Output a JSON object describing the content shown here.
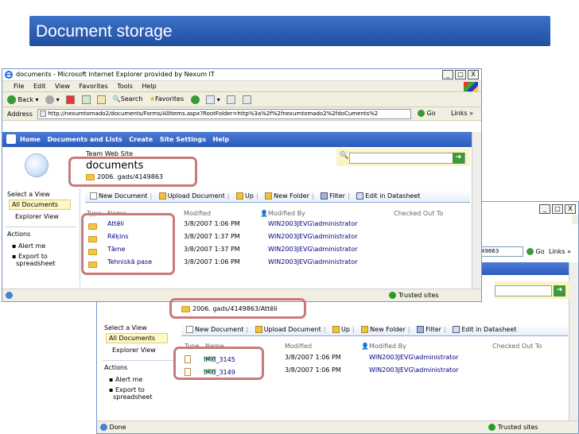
{
  "slide": {
    "title": "Document storage"
  },
  "browser": {
    "window_title": "documents - Microsoft Internet Explorer provided by Nexum IT",
    "window_buttons": [
      "_",
      "□",
      "X"
    ],
    "menu": [
      "File",
      "Edit",
      "View",
      "Favorites",
      "Tools",
      "Help"
    ],
    "toolbar": {
      "back": "Back",
      "search": "Search",
      "favorites": "Favorites"
    },
    "address_label": "Address",
    "address_value": "http://nexumtomado2/documents/Forms/AllItems.aspx?RootFolder=http%3a%2f%2fnexumtomado2%2fdoCuments%2",
    "address_value_short": "49863",
    "go": "Go",
    "links": "Links",
    "more": "»"
  },
  "sharepoint": {
    "topnav": [
      "Home",
      "Documents and Lists",
      "Create",
      "Site Settings",
      "Help"
    ],
    "site_name": "Team Web Site",
    "library_title": "documents",
    "breadcrumb_1": "2006. gads/4149863",
    "breadcrumb_2": "2006. gads/4149863/Attēli",
    "left_nav": {
      "select_view": "Select a View",
      "all_documents": "All Documents",
      "explorer_view": "Explorer View",
      "actions": "Actions",
      "alert_me": "Alert me",
      "export_1": "Export to",
      "export_2": "spreadsheet"
    },
    "doc_toolbar": [
      "New Document",
      "Upload Document",
      "Up",
      "New Folder",
      "Filter",
      "Edit in Datasheet"
    ],
    "columns": {
      "type": "Type",
      "name": "Name",
      "modified": "Modified",
      "modified_by": "Modified By",
      "checked_out_to": "Checked Out To"
    },
    "folders": [
      {
        "name": "Attēli",
        "modified": "3/8/2007 1:06 PM",
        "by": "WIN2003JEVG\\administrator"
      },
      {
        "name": "Rēķins",
        "modified": "3/8/2007 1:37 PM",
        "by": "WIN2003JEVG\\administrator"
      },
      {
        "name": "Tāme",
        "modified": "3/8/2007 1:37 PM",
        "by": "WIN2003JEVG\\administrator"
      },
      {
        "name": "Tehniskā pase",
        "modified": "3/8/2007 1:06 PM",
        "by": "WIN2003JEVG\\administrator"
      }
    ],
    "images": [
      {
        "name": "IMG_3145",
        "badge": "NEW",
        "modified": "3/8/2007 1:06 PM",
        "by": "WIN2003JEVG\\administrator"
      },
      {
        "name": "IMG_3149",
        "badge": "NEW",
        "modified": "3/8/2007 1:06 PM",
        "by": "WIN2003JEVG\\administrator"
      }
    ]
  },
  "status": {
    "done": "Done",
    "zone": "Trusted sites"
  }
}
